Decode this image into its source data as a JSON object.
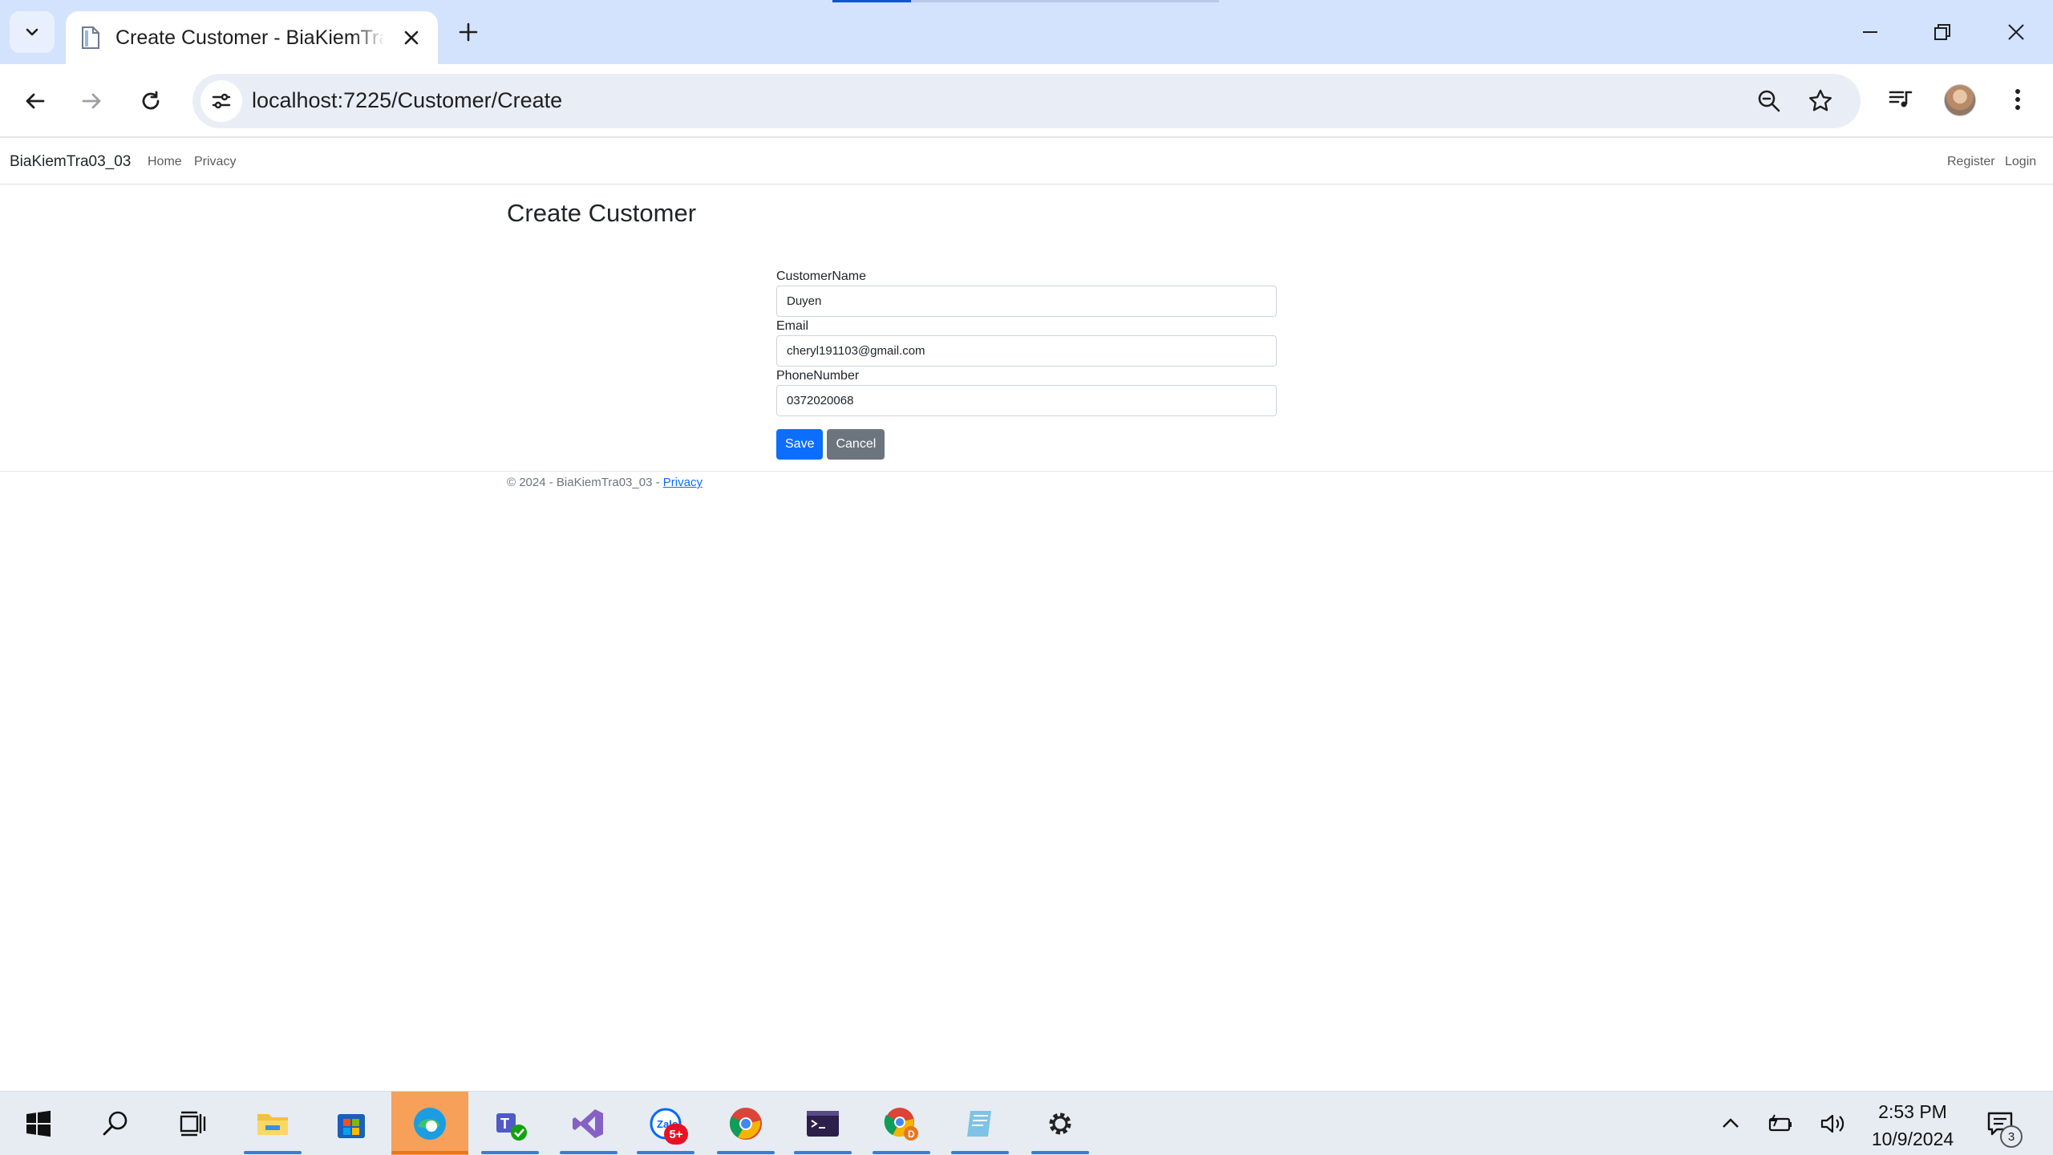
{
  "browser": {
    "tab_title": "Create Customer - BiaKiemTra03_03",
    "url": "localhost:7225/Customer/Create"
  },
  "site": {
    "brand": "BiaKiemTra03_03",
    "nav": {
      "home": "Home",
      "privacy": "Privacy",
      "register": "Register",
      "login": "Login"
    }
  },
  "page": {
    "title": "Create Customer",
    "fields": [
      {
        "label": "CustomerName",
        "value": "Duyen"
      },
      {
        "label": "Email",
        "value": "cheryl191103@gmail.com"
      },
      {
        "label": "PhoneNumber",
        "value": "0372020068"
      }
    ],
    "save_label": "Save",
    "cancel_label": "Cancel"
  },
  "footer": {
    "text": "© 2024 - BiaKiemTra03_03 - ",
    "privacy_link": "Privacy"
  },
  "taskbar": {
    "time": "2:53 PM",
    "date": "10/9/2024",
    "zalo_badge": "5+",
    "notification_count": "3",
    "apps": [
      "start",
      "search",
      "task-view",
      "file-explorer",
      "microsoft-store",
      "edge",
      "teams",
      "visual-studio",
      "zalo",
      "chrome",
      "terminal",
      "chrome-profile",
      "notepad",
      "settings"
    ]
  },
  "colors": {
    "tabstrip": "#d3e3fd",
    "primary_button": "#0d6efd",
    "secondary_button": "#6c757d",
    "link": "#0d6efd"
  }
}
